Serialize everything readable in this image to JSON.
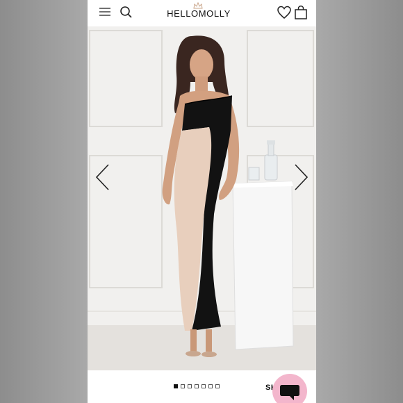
{
  "header": {
    "brand": "HELLOMOLLY",
    "icons": [
      "menu-icon",
      "search-icon",
      "heart-icon",
      "shopping-bag-icon"
    ]
  },
  "product": {
    "image": "model-in-black-and-nude-strapless-maxi-dress",
    "carousel_total": 7,
    "carousel_active": 1
  },
  "footer": {
    "share_label": "SH"
  },
  "colors": {
    "chat_button": "#f3b6cc",
    "dress_black": "#111111",
    "dress_nude": "#e8cfbd"
  }
}
